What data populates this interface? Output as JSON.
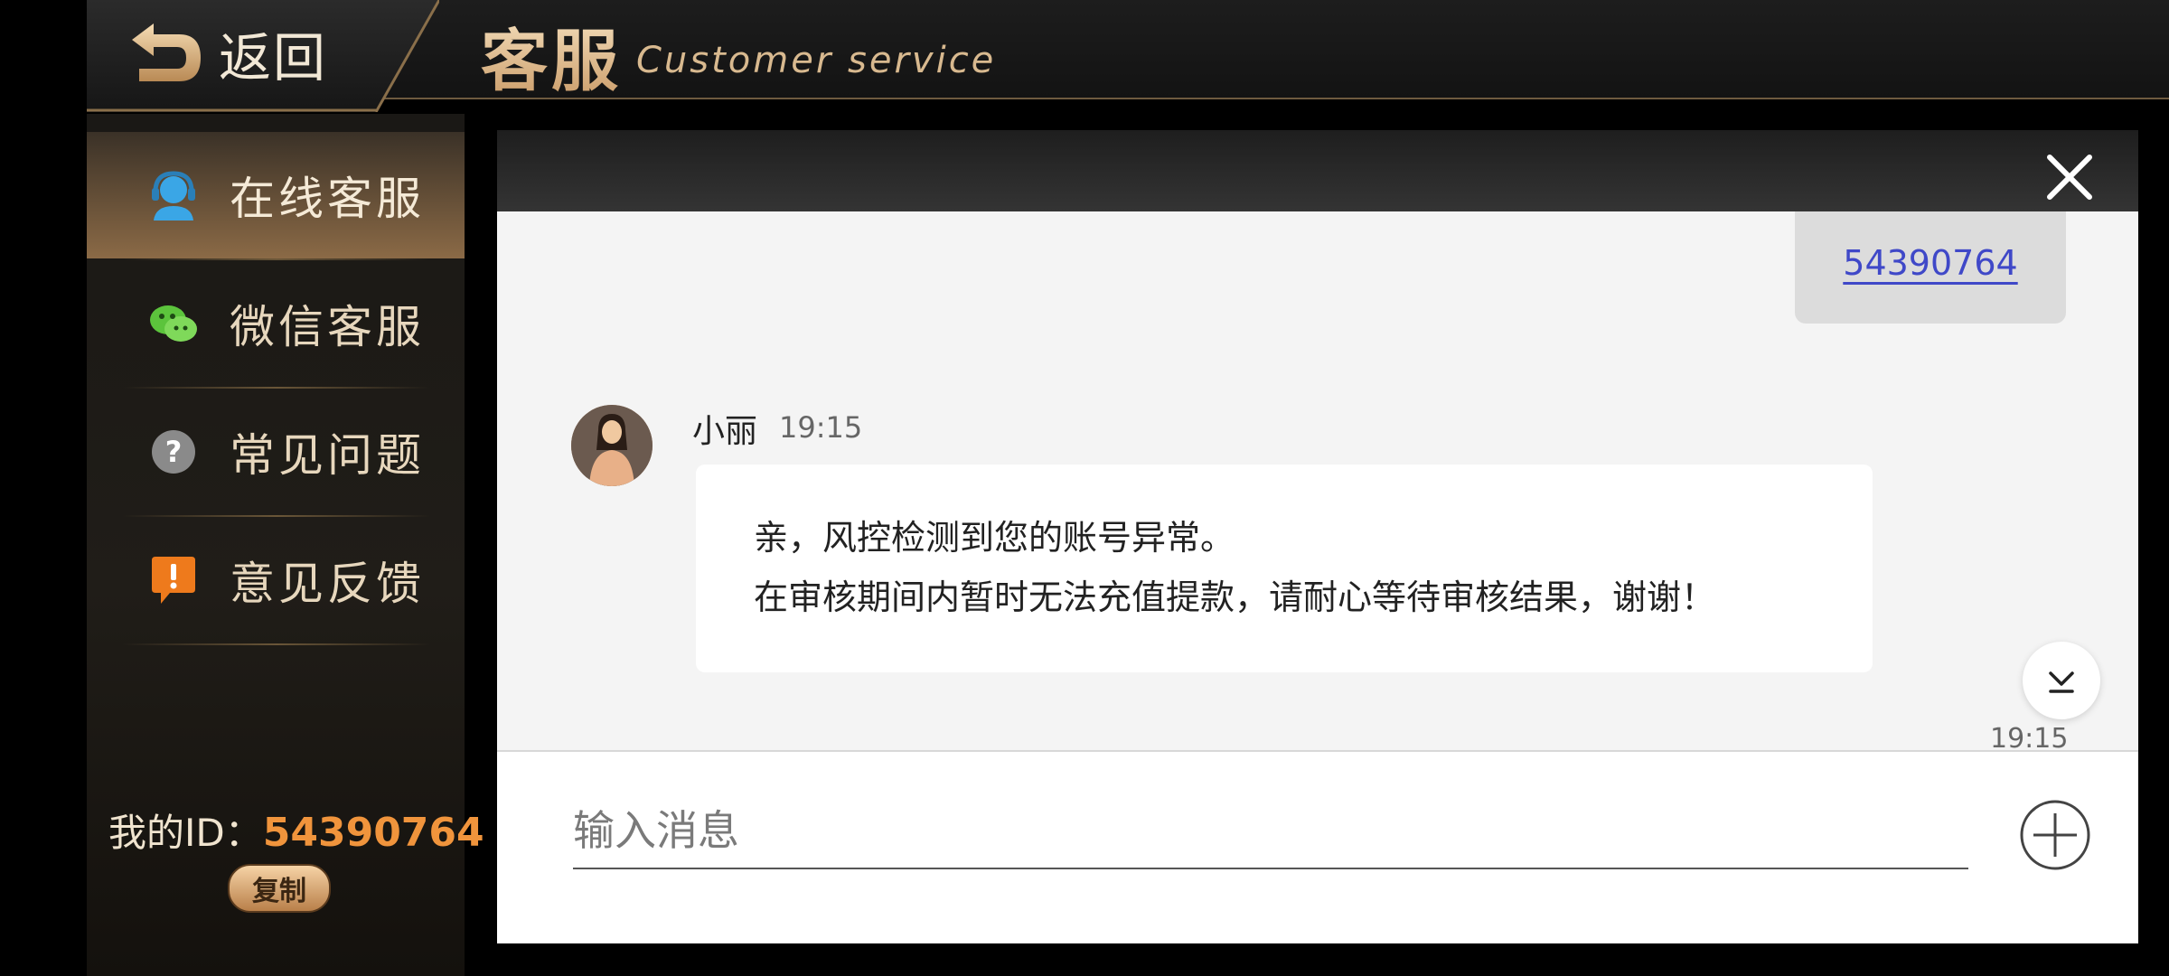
{
  "header": {
    "back_label": "返回",
    "title_cn": "客服",
    "title_en": "Customer service"
  },
  "sidebar": {
    "items": [
      {
        "label": "在线客服",
        "icon": "online-service-icon",
        "active": true
      },
      {
        "label": "微信客服",
        "icon": "wechat-icon",
        "active": false
      },
      {
        "label": "常见问题",
        "icon": "question-icon",
        "active": false
      },
      {
        "label": "意见反馈",
        "icon": "feedback-icon",
        "active": false
      }
    ],
    "my_id_label": "我的ID：",
    "my_id_value": "54390764",
    "copy_label": "复制"
  },
  "chat": {
    "sent_message": "54390764",
    "agent_name": "小丽",
    "agent_time": "19:15",
    "agent_lines": [
      "亲，风控检测到您的账号异常。",
      "在审核期间内暂时无法充值提款，请耐心等待审核结果，谢谢！"
    ],
    "bottom_time": "19:15",
    "input_placeholder": "输入消息"
  },
  "colors": {
    "accent_gold": "#d8b98f",
    "id_orange": "#f0943c",
    "link_blue": "#3f48c8"
  }
}
